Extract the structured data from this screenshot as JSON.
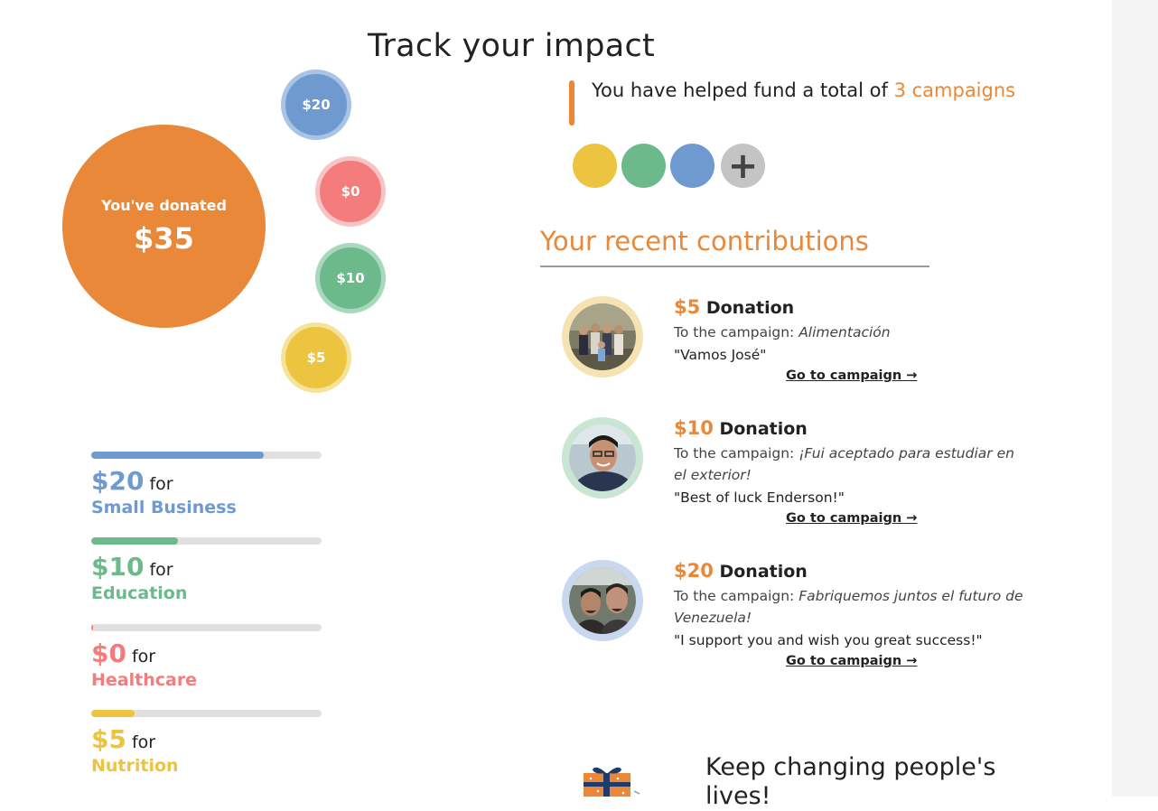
{
  "page_title": "Track your impact",
  "total": {
    "label": "You've donated",
    "amount": "$35",
    "color": "#e88838"
  },
  "bubbles": [
    {
      "label": "$20",
      "color": "#6f9ad0",
      "ring": "#a9c3e6"
    },
    {
      "label": "$0",
      "color": "#f47c7c",
      "ring": "#f7c4c4"
    },
    {
      "label": "$10",
      "color": "#6cba8c",
      "ring": "#a9d9bd"
    },
    {
      "label": "$5",
      "color": "#ecc440",
      "ring": "#f6e39a"
    }
  ],
  "categories": [
    {
      "amount": "$20",
      "for": "for",
      "name": "Small Business",
      "color": "#6f9ad0",
      "progress": 0.75
    },
    {
      "amount": "$10",
      "for": "for",
      "name": "Education",
      "color": "#6cba8c",
      "progress": 0.375
    },
    {
      "amount": "$0",
      "for": "for",
      "name": "Healthcare",
      "color": "#f47c7c",
      "progress": 0.0
    },
    {
      "amount": "$5",
      "for": "for",
      "name": "Nutrition",
      "color": "#ecc440",
      "progress": 0.19
    }
  ],
  "impact": {
    "prefix": "You have helped fund a total of",
    "highlight": "3 campaigns",
    "dot_colors": [
      "#ecc440",
      "#6cba8c",
      "#6f9ad0"
    ],
    "add_symbol": "+"
  },
  "recent_title": "Your recent contributions",
  "contributions": [
    {
      "amount": "$5",
      "type": "Donation",
      "to_label": "To the campaign:",
      "campaign": "Alimentación",
      "message": "\"Vamos José\"",
      "link": "Go to campaign →",
      "ring": "#f6e3b4"
    },
    {
      "amount": "$10",
      "type": "Donation",
      "to_label": "To the campaign:",
      "campaign": "¡Fui aceptado para estudiar en el exterior!",
      "message": "\"Best of luck Enderson!\"",
      "link": "Go to campaign →",
      "ring": "#c8e6d3"
    },
    {
      "amount": "$20",
      "type": "Donation",
      "to_label": "To the campaign:",
      "campaign": "Fabriquemos juntos el futuro de Venezuela!",
      "message": "\"I support you and wish you great success!\"",
      "link": "Go to campaign →",
      "ring": "#c9d8ee"
    }
  ],
  "keep_changing": "Keep changing people's lives!"
}
